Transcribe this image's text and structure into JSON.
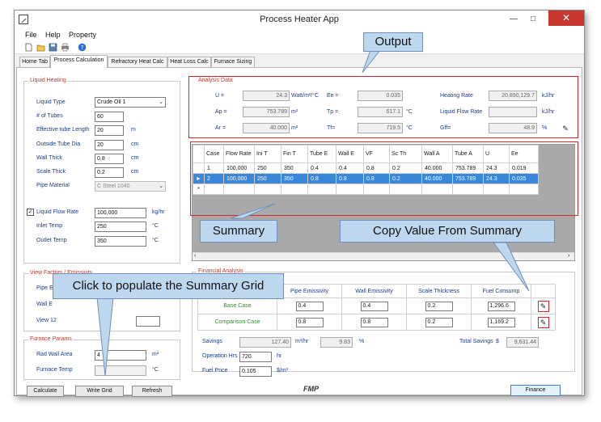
{
  "window": {
    "title": "Process Heater App"
  },
  "menu": {
    "file": "File",
    "help": "Help",
    "property": "Property"
  },
  "tabs": [
    "Home Tab",
    "Process Calculation",
    "Refractory Heat Calc",
    "Heat Loss Calc",
    "Furnace Sizing"
  ],
  "liquid_heating": {
    "title": "Liquid Heating",
    "liquid_type_label": "Liquid Type",
    "liquid_type_value": "Crude Oil 1",
    "tubes_label": "# of Tubes",
    "tubes_value": "60",
    "tube_length_label": "Effective tube Length",
    "tube_length_value": "20",
    "tube_length_unit": "m",
    "tube_dia_label": "Outside Tube Dia",
    "tube_dia_value": "20",
    "tube_dia_unit": "cm",
    "wall_thick_label": "Wall Thick",
    "wall_thick_value": "0.8",
    "wall_thick_unit": "cm",
    "scale_thick_label": "Scale Thick",
    "scale_thick_value": "0.2",
    "scale_thick_unit": "cm",
    "pipe_material_label": "Pipe Material",
    "pipe_material_value": "C Steel 1040",
    "flow_rate_label": "Liquid Flow Rate",
    "flow_rate_value": "100,000",
    "flow_rate_unit": "kg/hr",
    "inlet_temp_label": "Inlet Temp",
    "inlet_temp_value": "250",
    "inlet_temp_unit": "°C",
    "outlet_temp_label": "Outlet Temp",
    "outlet_temp_value": "350",
    "outlet_temp_unit": "°C"
  },
  "view_factors": {
    "title": "View Factors / Emissivity",
    "pipe_label": "Pipe E",
    "wall_label": "Wall E",
    "view12_label": "View 12"
  },
  "furnace_params": {
    "title": "Furnace Params",
    "rad_wall_label": "Rad Wall Area",
    "rad_wall_value": "4",
    "rad_wall_unit": "m²",
    "furnace_temp_label": "Furnace Temp",
    "furnace_temp_unit": "°C"
  },
  "buttons": {
    "calculate": "Calculate",
    "write_grid": "Write Grid",
    "refresh": "Refresh",
    "finance": "Finance"
  },
  "analysis": {
    "title": "Analysis Data",
    "u_label": "U =",
    "u_value": "24.3",
    "u_unit": "Watt/m²/°C",
    "ap_label": "Ap =",
    "ap_value": "753.789",
    "ap_unit": "m²",
    "ar_label": "Ar =",
    "ar_value": "40.000",
    "ar_unit": "m²",
    "ee_label": "Ee =",
    "ee_value": "0.035",
    "tp_label": "Tp =",
    "tp_value": "617.1",
    "tp_unit": "°C",
    "tf_label": "Tf=",
    "tf_value": "719.5",
    "tf_unit": "°C",
    "heating_rate_label": "Heating Rate",
    "heating_rate_value": "20,890,129.7",
    "heating_rate_unit": "kJ/hr",
    "liquid_flow_label": "Liquid Flow Rate",
    "liquid_flow_value": "",
    "liquid_flow_unit": "kJ/hr",
    "gff_label": "Gff=",
    "gff_value": "48.9",
    "gff_unit": "%"
  },
  "summary_grid": {
    "headers": [
      "Case",
      "Flow Rate",
      "Ini T",
      "Fin T",
      "Tube E",
      "Wall E",
      "VF",
      "Sc Th",
      "Wall A",
      "Tube A",
      "U",
      "Ee"
    ],
    "rows": [
      [
        "1",
        "100,000",
        "250",
        "350",
        "0.4",
        "0.4",
        "0.8",
        "0.2",
        "40.000",
        "753.789",
        "24.3",
        "0.019"
      ],
      [
        "2",
        "100,000",
        "250",
        "350",
        "0.8",
        "0.8",
        "0.8",
        "0.2",
        "40.000",
        "753.789",
        "24.3",
        "0.035"
      ]
    ],
    "new_row_marker": "*"
  },
  "financial": {
    "title": "Financial Analysis",
    "headers": [
      "Pipe Emissivity",
      "Wall Emissivity",
      "Scale Thickness",
      "Fuel Consump"
    ],
    "base_label": "Base Case",
    "base": [
      "0.4",
      "0.4",
      "0.2",
      "1,296.6"
    ],
    "comparison_label": "Comparison Case",
    "comparison": [
      "0.8",
      "0.8",
      "0.2",
      "1,169.2"
    ],
    "savings_label": "Savings",
    "savings_value": "127.40",
    "savings_unit": "m³/hr",
    "savings_pct": "9.83",
    "savings_pct_unit": "%",
    "total_savings_label": "Total Savings",
    "total_savings_currency": "$",
    "total_savings_value": "9,631.44",
    "operation_label": "Operation Hrs",
    "operation_value": "720",
    "operation_unit": "hr",
    "fuel_price_label": "Fuel Price",
    "fuel_price_value": "0.105",
    "fuel_price_unit": "$/m³"
  },
  "logo": "FMP",
  "callouts": {
    "output": "Output",
    "summary": "Summary",
    "copy_value": "Copy Value From Summary",
    "populate": "Click to populate the Summary Grid"
  }
}
